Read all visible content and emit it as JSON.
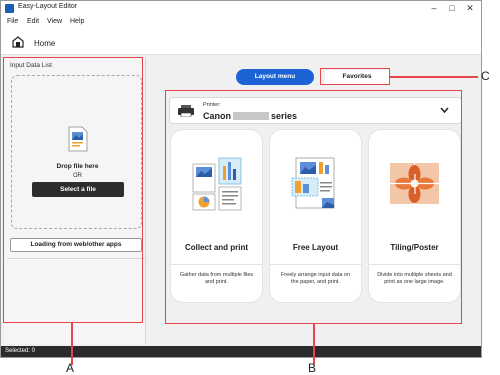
{
  "window": {
    "title": "Easy-Layout Editor",
    "controls": [
      "–",
      "□",
      "✕"
    ]
  },
  "menu": [
    "File",
    "Edit",
    "View",
    "Help"
  ],
  "home": {
    "label": "Home"
  },
  "left_panel": {
    "title": "Input Data List",
    "drop_text": "Drop file here",
    "or_text": "OR",
    "select_button": "Select a file",
    "load_button": "Loading from web/other apps"
  },
  "tabs": {
    "layout_menu": "Layout menu",
    "favorites": "Favorites"
  },
  "printer": {
    "label": "Printer:",
    "name_prefix": "Canon",
    "name_suffix": "series"
  },
  "cards": [
    {
      "title": "Collect and print",
      "desc": "Gather data from multiple files and print."
    },
    {
      "title": "Free Layout",
      "desc": "Freely arrange input data on the paper, and print."
    },
    {
      "title": "Tiling/Poster",
      "desc": "Divide into multiple sheets and print as one large image."
    }
  ],
  "status": {
    "text": "Selected: 0"
  },
  "callouts": {
    "a": "A",
    "b": "B",
    "c": "C"
  },
  "colors": {
    "accent": "#1c64d6",
    "callout": "#e8454a",
    "status_bg": "#2b2b2b"
  }
}
